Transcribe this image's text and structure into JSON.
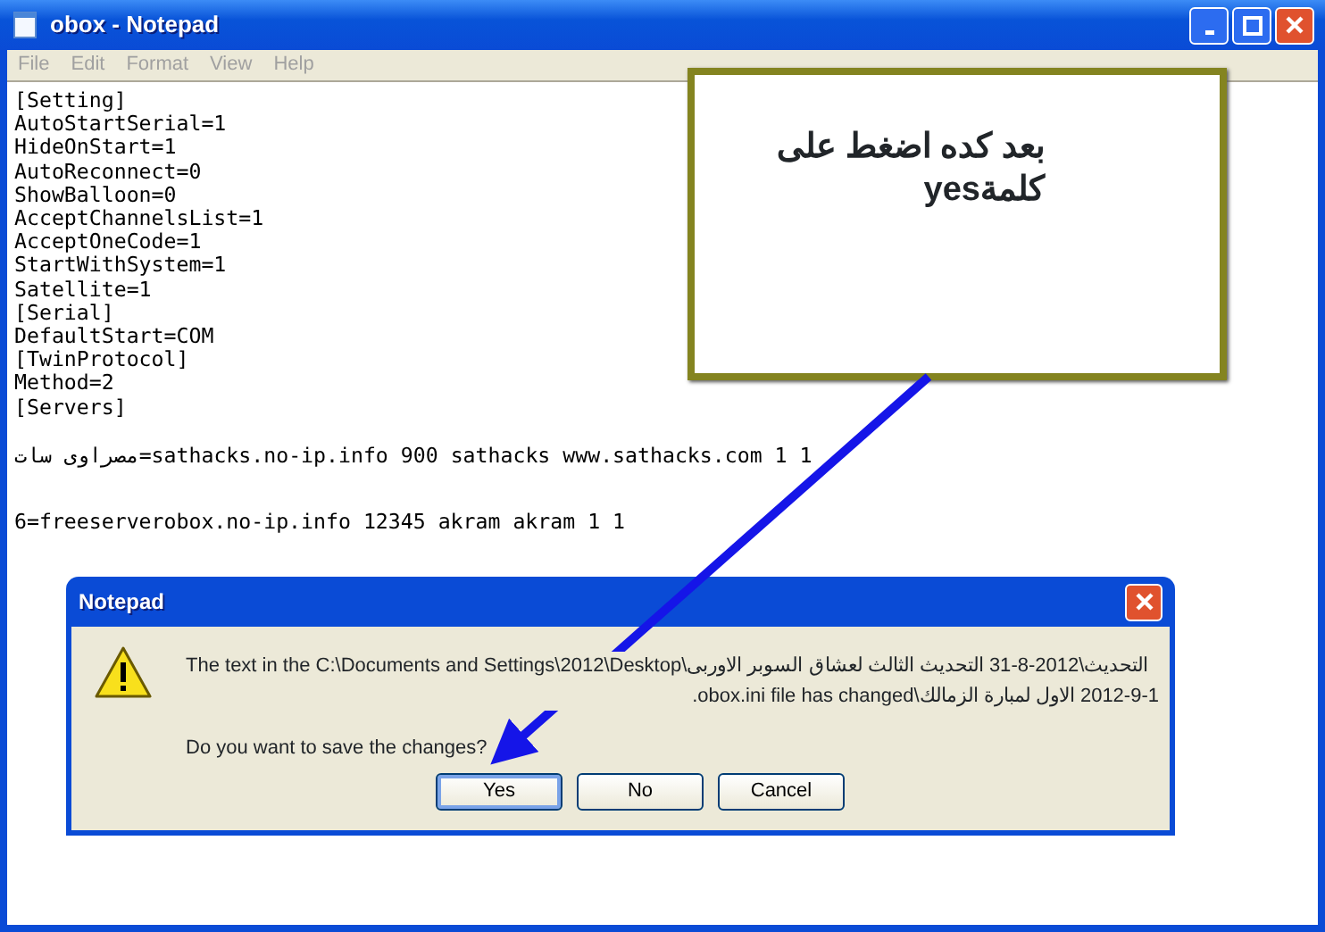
{
  "window": {
    "title": "obox - Notepad"
  },
  "menu": [
    "File",
    "Edit",
    "Format",
    "View",
    "Help"
  ],
  "editor": {
    "lines": [
      "[Setting]",
      "AutoStartSerial=1",
      "HideOnStart=1",
      "AutoReconnect=0",
      "ShowBalloon=0",
      "AcceptChannelsList=1",
      "AcceptOneCode=1",
      "StartWithSystem=1",
      "Satellite=1",
      "[Serial]",
      "DefaultStart=COM",
      "[TwinProtocol]",
      "Method=2",
      "[Servers]"
    ],
    "server_lines": [
      "مصراوى سات=sathacks.no-ip.info 900 sathacks www.sathacks.com 1 1",
      "6=freeserverobox.no-ip.info 12345 akram akram 1 1"
    ]
  },
  "callout": {
    "lines": [
      "بعد كده اضغط على",
      "كلمةyes"
    ]
  },
  "dialog": {
    "title": "Notepad",
    "message_lines": [
      "The text in the C:\\Documents and Settings\\2012\\Desktop\\التحديث\\2012-8-31 التحديث الثالث لعشاق السوبر الاوربى",
      "2012-9-1 الاول لمبارة الزمالك\\obox.ini file has changed."
    ],
    "question": "Do you want to save the changes?",
    "buttons": [
      {
        "label": "Yes",
        "selected": true
      },
      {
        "label": "No",
        "selected": false
      },
      {
        "label": "Cancel",
        "selected": false
      }
    ]
  }
}
